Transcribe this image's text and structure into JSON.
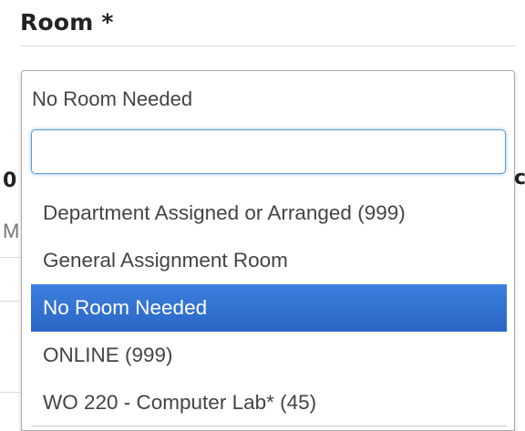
{
  "field": {
    "label": "Room *"
  },
  "background": {
    "left_fragment": "0",
    "left_fragment_2": "M",
    "right_fragment": "c"
  },
  "dropdown": {
    "selected_value": "No Room Needed",
    "search": {
      "value": "",
      "placeholder": ""
    },
    "options": [
      {
        "label": "Department Assigned or Arranged (999)",
        "selected": false
      },
      {
        "label": "General Assignment Room",
        "selected": false
      },
      {
        "label": "No Room Needed",
        "selected": true
      },
      {
        "label": "ONLINE (999)",
        "selected": false
      },
      {
        "label": "WO 220 - Computer Lab* (45)",
        "selected": false
      }
    ]
  },
  "colors": {
    "highlight": "#2f6fd0",
    "search_focus_border": "#5b9bd5"
  }
}
